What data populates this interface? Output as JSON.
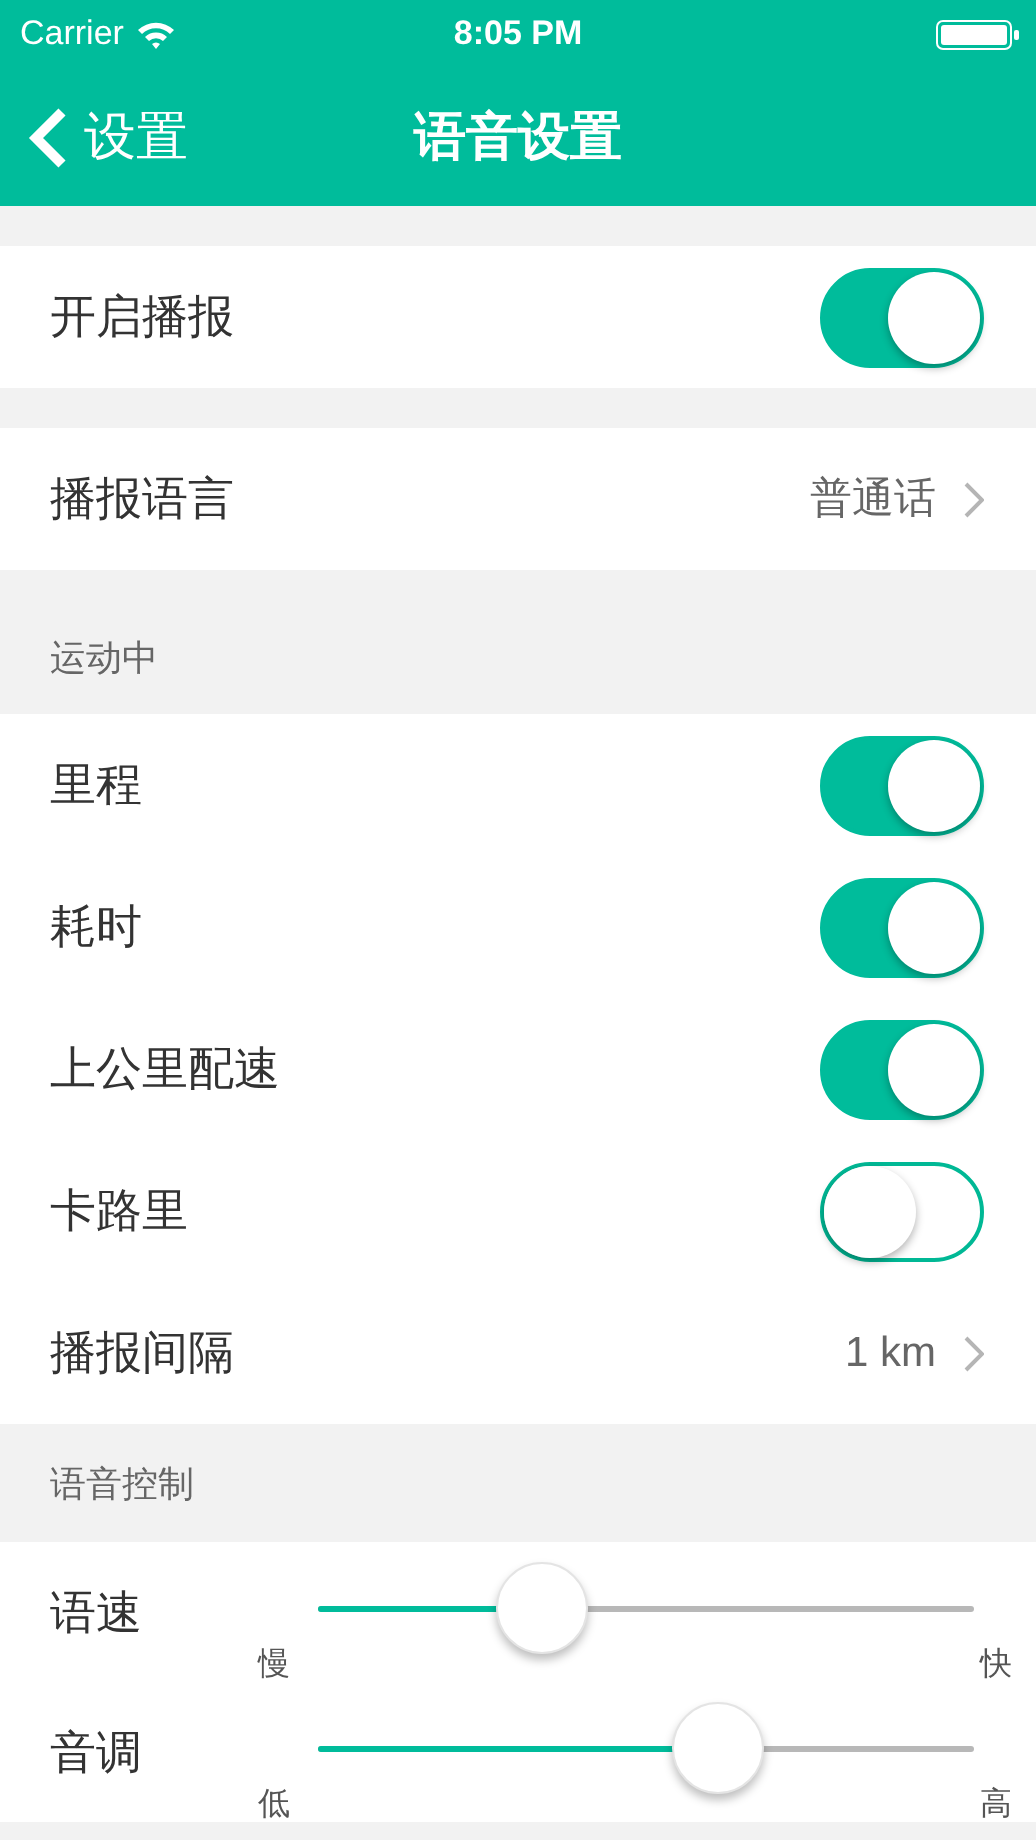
{
  "status_bar": {
    "carrier": "Carrier",
    "time": "8:05 PM"
  },
  "nav": {
    "back_label": "设置",
    "title": "语音设置"
  },
  "groups": [
    {
      "rows": [
        {
          "kind": "toggle",
          "label": "开启播报",
          "on": true
        }
      ]
    },
    {
      "rows": [
        {
          "kind": "link",
          "label": "播报语言",
          "value": "普通话"
        }
      ]
    },
    {
      "header": "运动中",
      "rows": [
        {
          "kind": "toggle",
          "label": "里程",
          "on": true
        },
        {
          "kind": "toggle",
          "label": "耗时",
          "on": true
        },
        {
          "kind": "toggle",
          "label": "上公里配速",
          "on": true
        },
        {
          "kind": "toggle",
          "label": "卡路里",
          "on": false
        },
        {
          "kind": "link",
          "label": "播报间隔",
          "value": "1 km"
        }
      ]
    },
    {
      "header": "语音控制",
      "rows": [
        {
          "kind": "slider",
          "label": "语速",
          "level": 0.34,
          "min_label": "慢",
          "max_label": "快"
        },
        {
          "kind": "slider",
          "label": "音调",
          "level": 0.61,
          "min_label": "低",
          "max_label": "高"
        }
      ]
    }
  ]
}
